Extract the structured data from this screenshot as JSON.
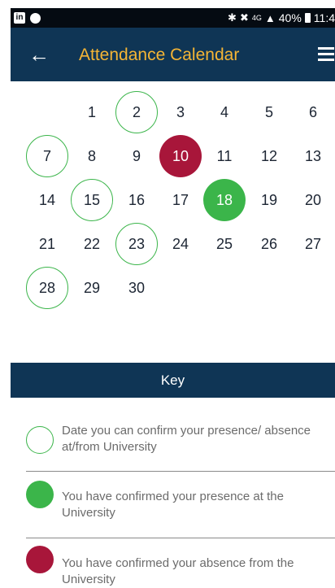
{
  "status_bar": {
    "left_app_icon": "linkedin-icon",
    "right_text": "40%",
    "time": "11:4",
    "network": "4G"
  },
  "header": {
    "title": "Attendance Calendar",
    "back_icon": "back-arrow-icon",
    "menu_icon": "hamburger-menu-icon"
  },
  "calendar": {
    "days": [
      {
        "label": "1",
        "state": "none"
      },
      {
        "label": "2",
        "state": "confirmable"
      },
      {
        "label": "3",
        "state": "none"
      },
      {
        "label": "4",
        "state": "none"
      },
      {
        "label": "5",
        "state": "none"
      },
      {
        "label": "6",
        "state": "none"
      },
      {
        "label": "7",
        "state": "confirmable"
      },
      {
        "label": "8",
        "state": "none"
      },
      {
        "label": "9",
        "state": "none"
      },
      {
        "label": "10",
        "state": "absent"
      },
      {
        "label": "11",
        "state": "none"
      },
      {
        "label": "12",
        "state": "none"
      },
      {
        "label": "13",
        "state": "none"
      },
      {
        "label": "14",
        "state": "none"
      },
      {
        "label": "15",
        "state": "confirmable"
      },
      {
        "label": "16",
        "state": "none"
      },
      {
        "label": "17",
        "state": "none"
      },
      {
        "label": "18",
        "state": "present"
      },
      {
        "label": "19",
        "state": "none"
      },
      {
        "label": "20",
        "state": "none"
      },
      {
        "label": "21",
        "state": "none"
      },
      {
        "label": "22",
        "state": "none"
      },
      {
        "label": "23",
        "state": "confirmable"
      },
      {
        "label": "24",
        "state": "none"
      },
      {
        "label": "25",
        "state": "none"
      },
      {
        "label": "26",
        "state": "none"
      },
      {
        "label": "27",
        "state": "none"
      },
      {
        "label": "28",
        "state": "confirmable"
      },
      {
        "label": "29",
        "state": "none"
      },
      {
        "label": "30",
        "state": "none"
      }
    ]
  },
  "key": {
    "title": "Key",
    "items": [
      {
        "text": "Date you can confirm your presence/ absence at/from University"
      },
      {
        "text": "You have confirmed your presence at the University"
      },
      {
        "text": "You have confirmed your absence from the University"
      }
    ]
  },
  "colors": {
    "navy": "#0f3555",
    "title_gold": "#f5b535",
    "present_green": "#3bb54a",
    "absent_red": "#a8163a"
  }
}
